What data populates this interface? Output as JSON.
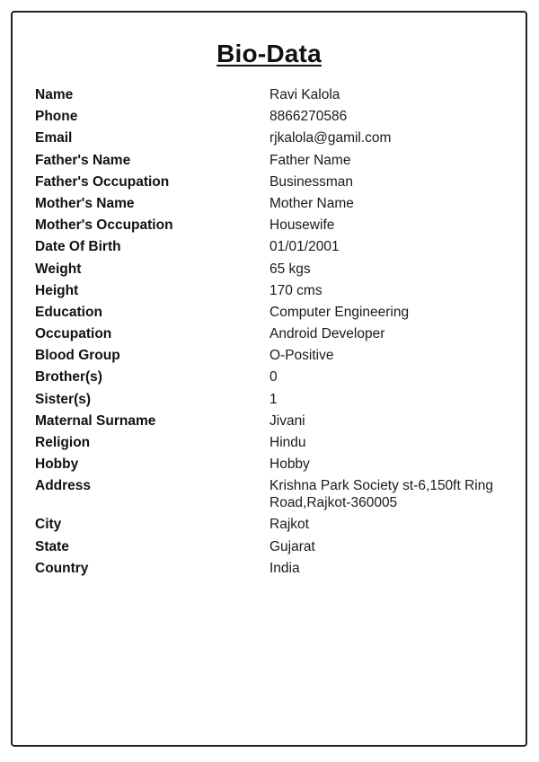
{
  "title": "Bio-Data",
  "fields": [
    {
      "label": "Name",
      "value": "Ravi Kalola"
    },
    {
      "label": "Phone",
      "value": "8866270586"
    },
    {
      "label": "Email",
      "value": "rjkalola@gamil.com"
    },
    {
      "label": "Father's Name",
      "value": "Father Name"
    },
    {
      "label": "Father's Occupation",
      "value": "Businessman"
    },
    {
      "label": "Mother's Name",
      "value": "Mother Name"
    },
    {
      "label": "Mother's Occupation",
      "value": "Housewife"
    },
    {
      "label": "Date Of Birth",
      "value": "01/01/2001"
    },
    {
      "label": "Weight",
      "value": "65 kgs"
    },
    {
      "label": "Height",
      "value": "170 cms"
    },
    {
      "label": "Education",
      "value": "Computer Engineering"
    },
    {
      "label": "Occupation",
      "value": "Android Developer"
    },
    {
      "label": "Blood Group",
      "value": "O-Positive"
    },
    {
      "label": "Brother(s)",
      "value": "0"
    },
    {
      "label": "Sister(s)",
      "value": "1"
    },
    {
      "label": "Maternal Surname",
      "value": "Jivani"
    },
    {
      "label": "Religion",
      "value": "Hindu"
    },
    {
      "label": "Hobby",
      "value": "Hobby"
    },
    {
      "label": "Address",
      "value": "Krishna Park Society st-6,150ft Ring Road,Rajkot-360005"
    },
    {
      "label": "City",
      "value": "Rajkot"
    },
    {
      "label": "State",
      "value": "Gujarat"
    },
    {
      "label": "Country",
      "value": "India"
    }
  ]
}
